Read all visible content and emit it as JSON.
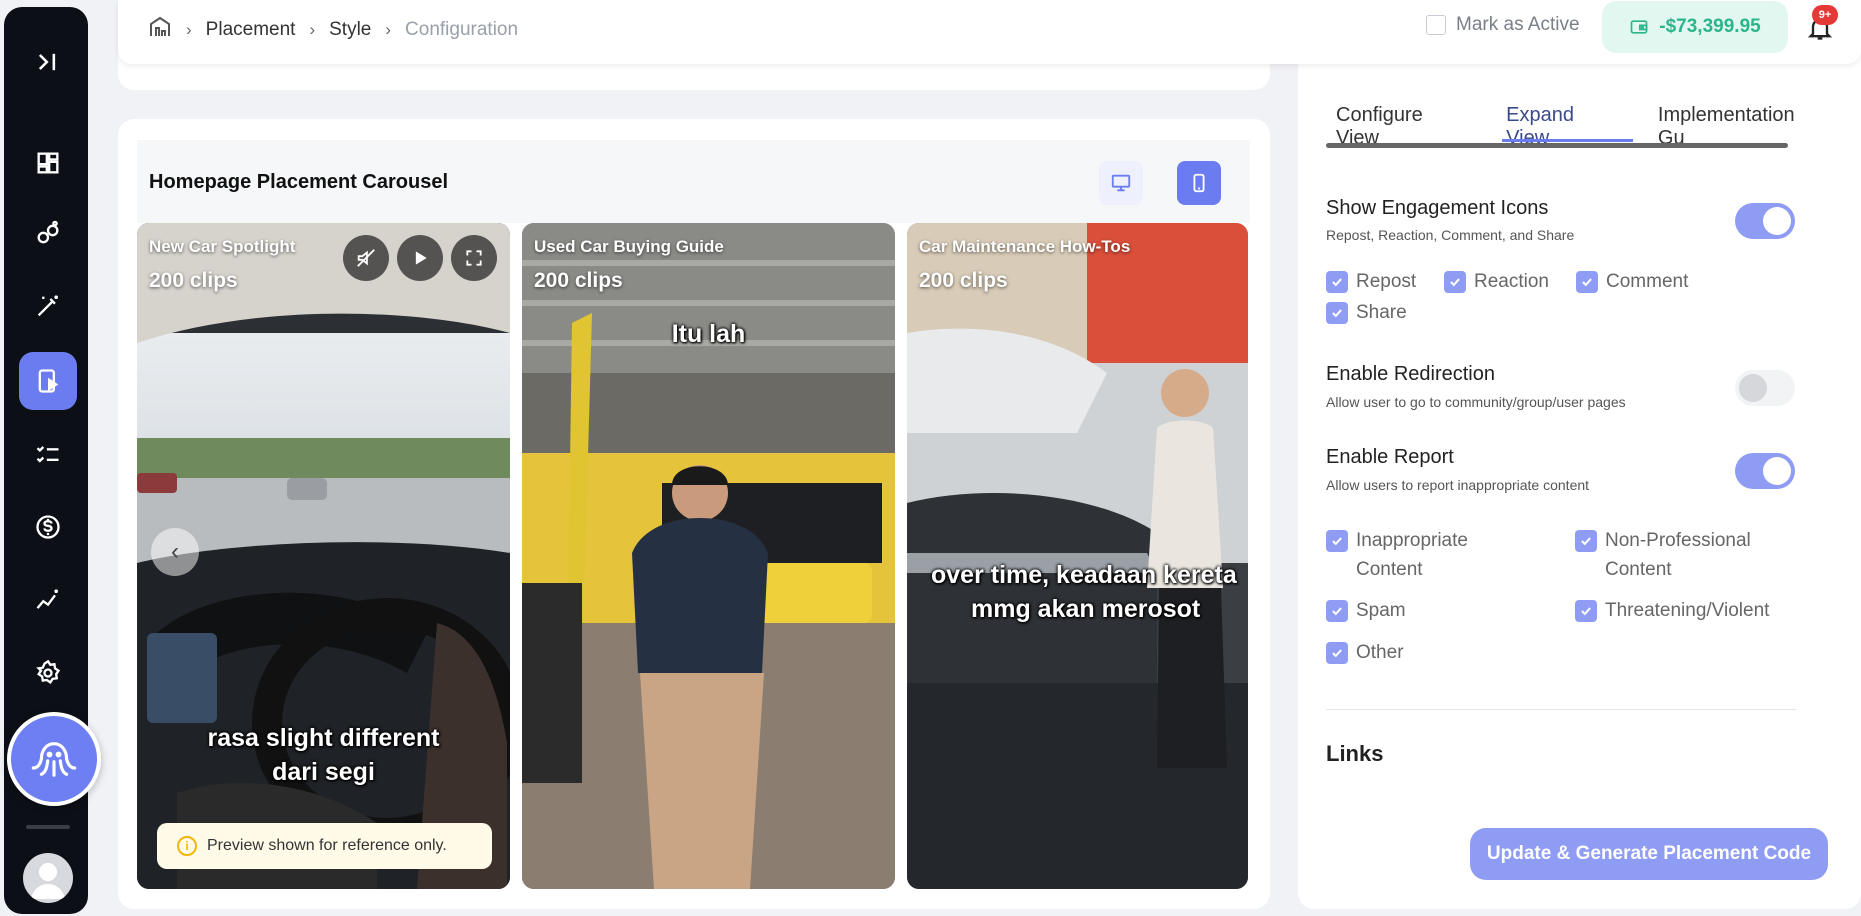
{
  "breadcrumb": {
    "items": [
      "Placement",
      "Style",
      "Configuration"
    ]
  },
  "header": {
    "mark_active_label": "Mark as Active",
    "balance": "-$73,399.95",
    "notification_badge": "9+"
  },
  "preview": {
    "title": "Homepage Placement Carousel",
    "notice": "Preview shown for reference only.",
    "clips": [
      {
        "title": "New Car Spotlight",
        "count": "200 clips",
        "caption_line1": "rasa slight different",
        "caption_line2": "dari segi"
      },
      {
        "title": "Used Car Buying Guide",
        "count": "200 clips",
        "caption_line1": "Itu lah",
        "caption_line2": ""
      },
      {
        "title": "Car Maintenance How-Tos",
        "count": "200 clips",
        "caption_line1": "over time, keadaan kereta",
        "caption_line2": "mmg akan merosot"
      }
    ]
  },
  "tabs": [
    "Configure View",
    "Expand View",
    "Implementation Gu"
  ],
  "settings": {
    "engagement": {
      "title": "Show Engagement Icons",
      "subtitle": "Repost, Reaction, Comment, and Share",
      "enabled": true,
      "options": [
        "Repost",
        "Reaction",
        "Comment",
        "Share"
      ]
    },
    "redirection": {
      "title": "Enable Redirection",
      "subtitle": "Allow user to go to community/group/user pages",
      "enabled": false
    },
    "report": {
      "title": "Enable Report",
      "subtitle": "Allow users to report inappropriate content",
      "enabled": true,
      "options": [
        {
          "line1": "Inappropriate",
          "line2": "Content"
        },
        {
          "line1": "Non-Professional",
          "line2": "Content"
        },
        {
          "line1": "Spam",
          "line2": ""
        },
        {
          "line1": "Threatening/Violent",
          "line2": ""
        },
        {
          "line1": "Other",
          "line2": ""
        }
      ]
    }
  },
  "links_title": "Links",
  "update_button": "Update & Generate Placement Code",
  "colors": {
    "accent": "#6b7cf0",
    "accent_light": "#8f9cf4",
    "balance_text": "#2bb58b",
    "sidebar_bg": "#0d0f17"
  }
}
